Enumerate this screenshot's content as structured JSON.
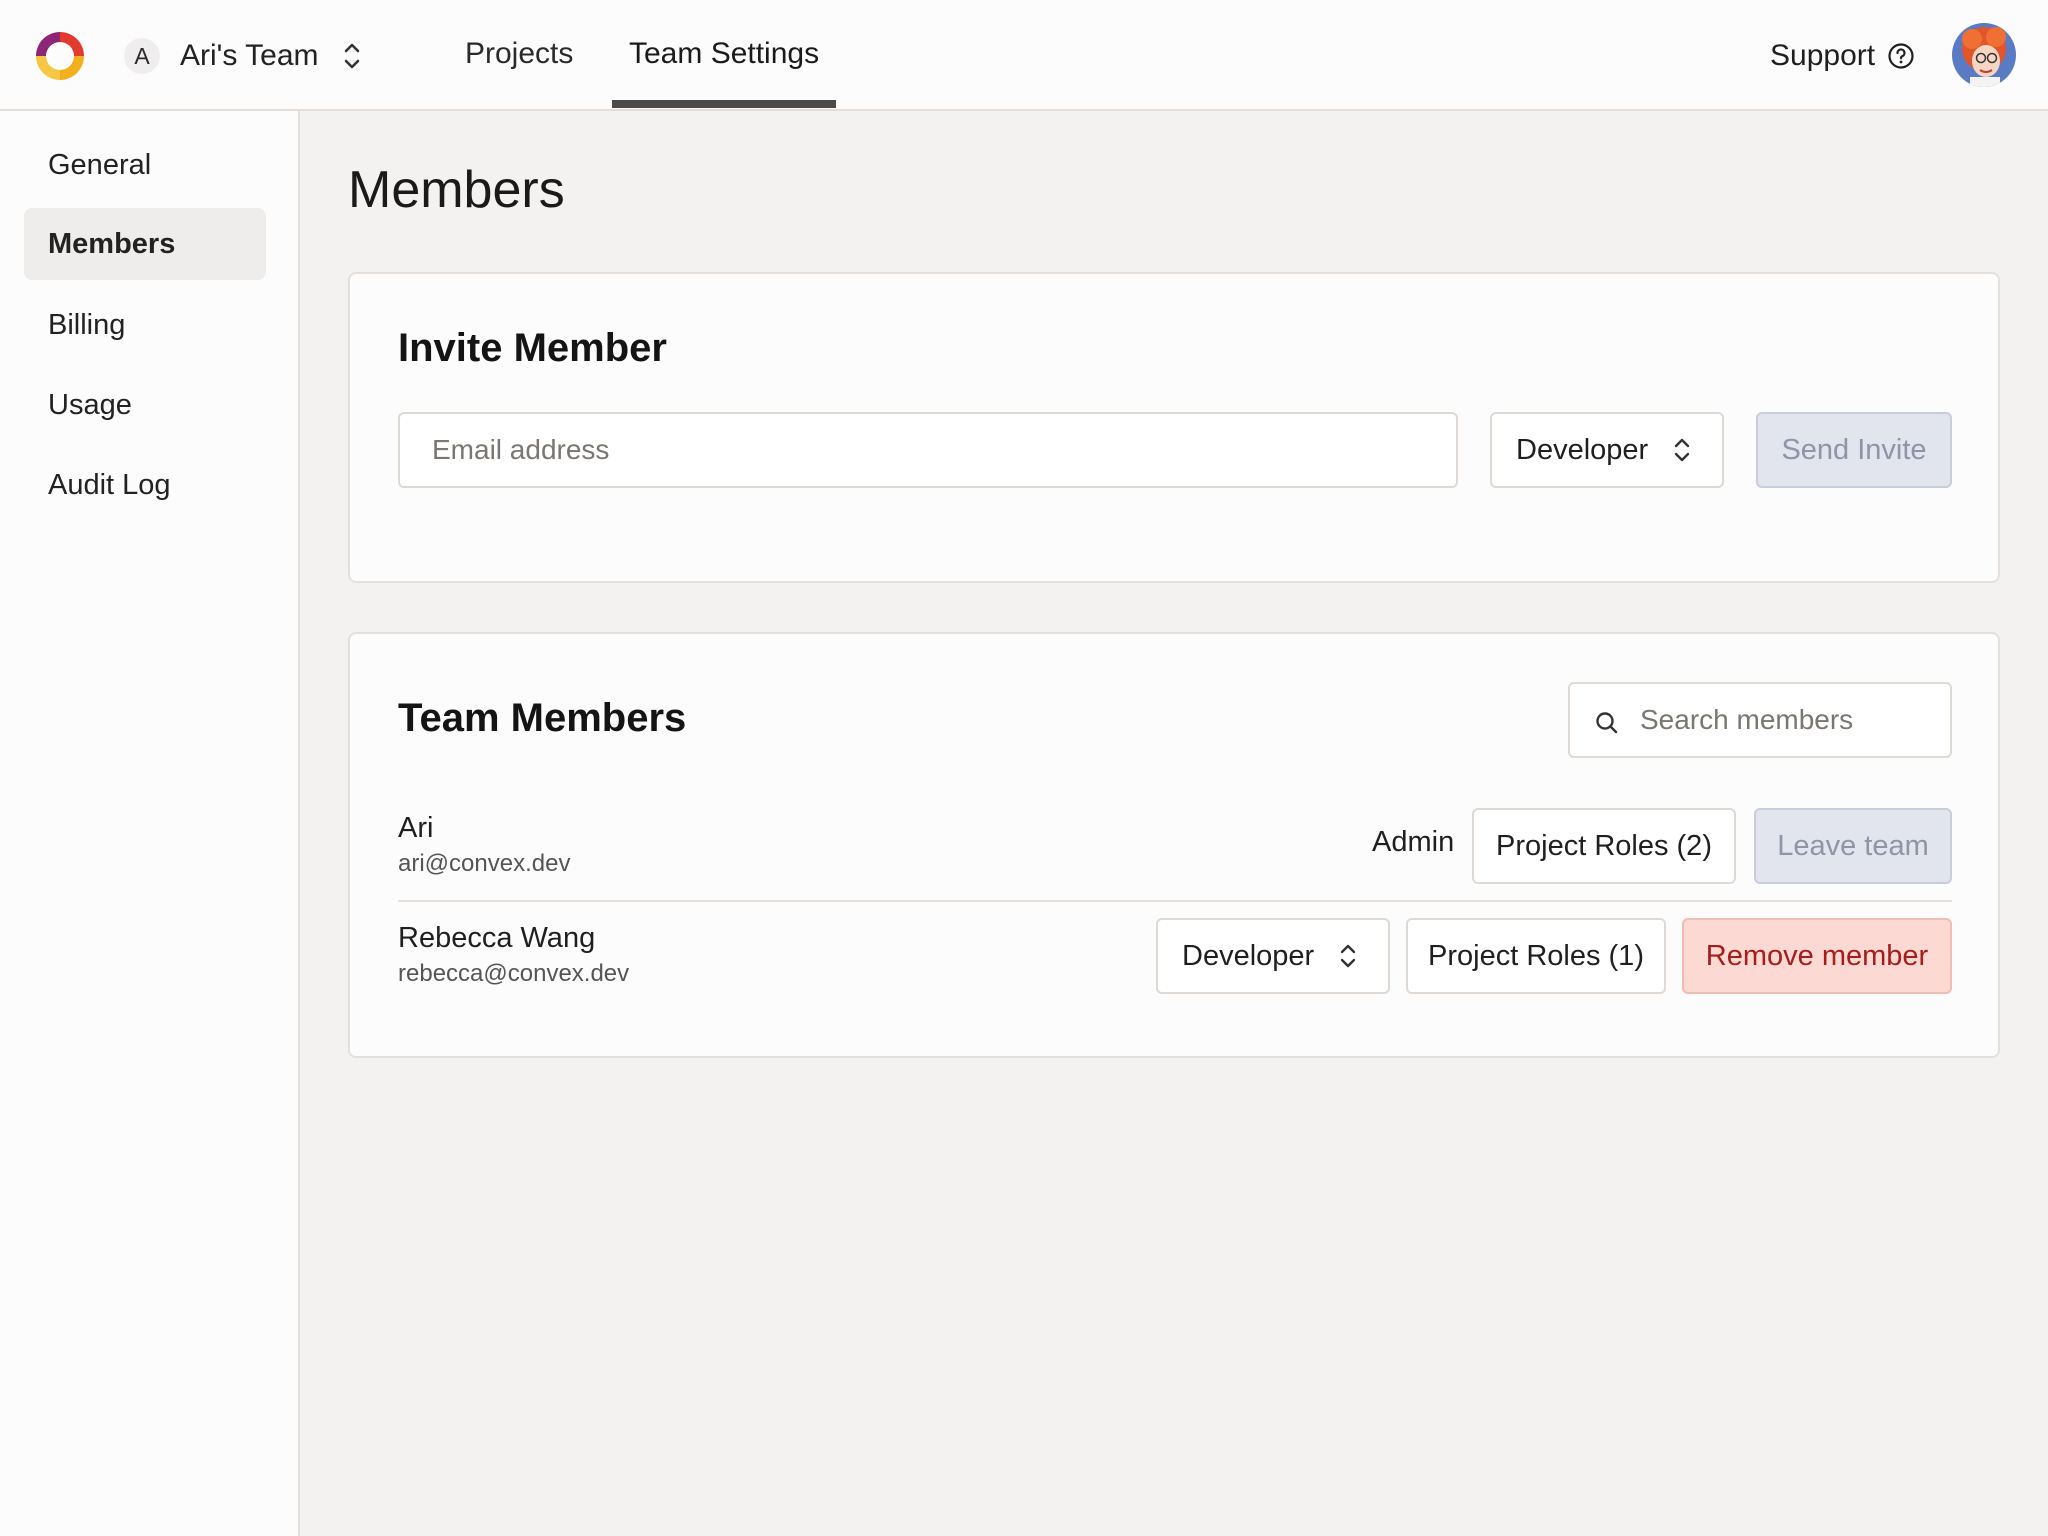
{
  "header": {
    "team": {
      "avatar_letter": "A",
      "name": "Ari's Team"
    },
    "tabs": [
      {
        "label": "Projects",
        "active": false
      },
      {
        "label": "Team Settings",
        "active": true
      }
    ],
    "support_label": "Support"
  },
  "sidebar": {
    "items": [
      {
        "label": "General",
        "active": false
      },
      {
        "label": "Members",
        "active": true
      },
      {
        "label": "Billing",
        "active": false
      },
      {
        "label": "Usage",
        "active": false
      },
      {
        "label": "Audit Log",
        "active": false
      }
    ]
  },
  "page": {
    "title": "Members"
  },
  "invite": {
    "title": "Invite Member",
    "email_placeholder": "Email address",
    "role_value": "Developer",
    "send_label": "Send Invite"
  },
  "members_card": {
    "title": "Team Members",
    "search_placeholder": "Search members",
    "members": [
      {
        "name": "Ari",
        "email": "ari@convex.dev",
        "role": "Admin",
        "project_roles_label": "Project Roles (2)",
        "action_label": "Leave team"
      },
      {
        "name": "Rebecca Wang",
        "email": "rebecca@convex.dev",
        "role": "Developer",
        "project_roles_label": "Project Roles (1)",
        "action_label": "Remove member"
      }
    ]
  },
  "colors": {
    "background": "#f4f2f0",
    "surface": "#fdfcfc",
    "danger_bg": "#fcd9d3",
    "danger_text": "#a51d1d",
    "disabled_bg": "#e2e5ee"
  }
}
